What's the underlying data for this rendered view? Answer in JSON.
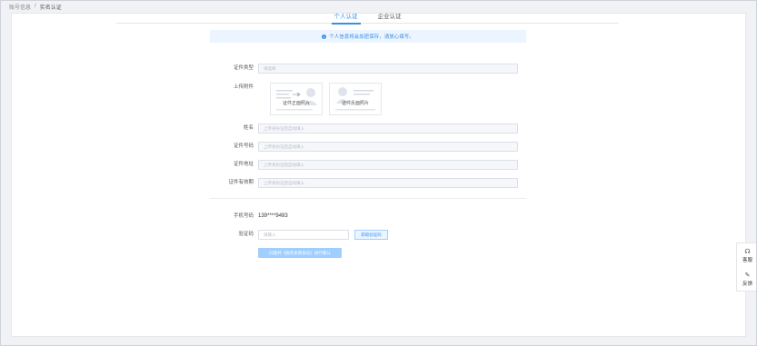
{
  "breadcrumb": {
    "parent": "账号信息",
    "separator": "/",
    "current": "实名认证"
  },
  "tabs": [
    {
      "label": "个人认证"
    },
    {
      "label": "企业认证"
    }
  ],
  "notice": {
    "text": "个人信息将会加密保存，请放心填写。"
  },
  "form": {
    "cert_type": {
      "label": "证件类型",
      "placeholder": "请选择"
    },
    "upload": {
      "label": "上传附件",
      "front_caption": "证件正面照片",
      "back_caption": "证件反面照片"
    },
    "name": {
      "label": "姓名",
      "placeholder": "上传身份证后自动填入"
    },
    "cert_number": {
      "label": "证件号码",
      "placeholder": "上传身份证后自动填入"
    },
    "cert_address": {
      "label": "证件地址",
      "placeholder": "上传身份证后自动填入"
    },
    "cert_validity": {
      "label": "证件有效期",
      "placeholder": "上传身份证后自动填入"
    },
    "phone": {
      "label": "手机号码",
      "value": "139****9493"
    },
    "code": {
      "label": "验证码",
      "placeholder": "请输入",
      "button": "获取验证码"
    },
    "submit": {
      "label": "同意并《服务条款协议》进行确认"
    }
  },
  "float_panel": {
    "service": {
      "label": "客服",
      "icon": "headset-icon"
    },
    "feedback": {
      "label": "反馈",
      "icon": "pencil-icon"
    }
  },
  "colors": {
    "accent": "#3a8ee6",
    "notice_bg": "#ecf5ff",
    "submit_disabled": "#a0cfff"
  }
}
